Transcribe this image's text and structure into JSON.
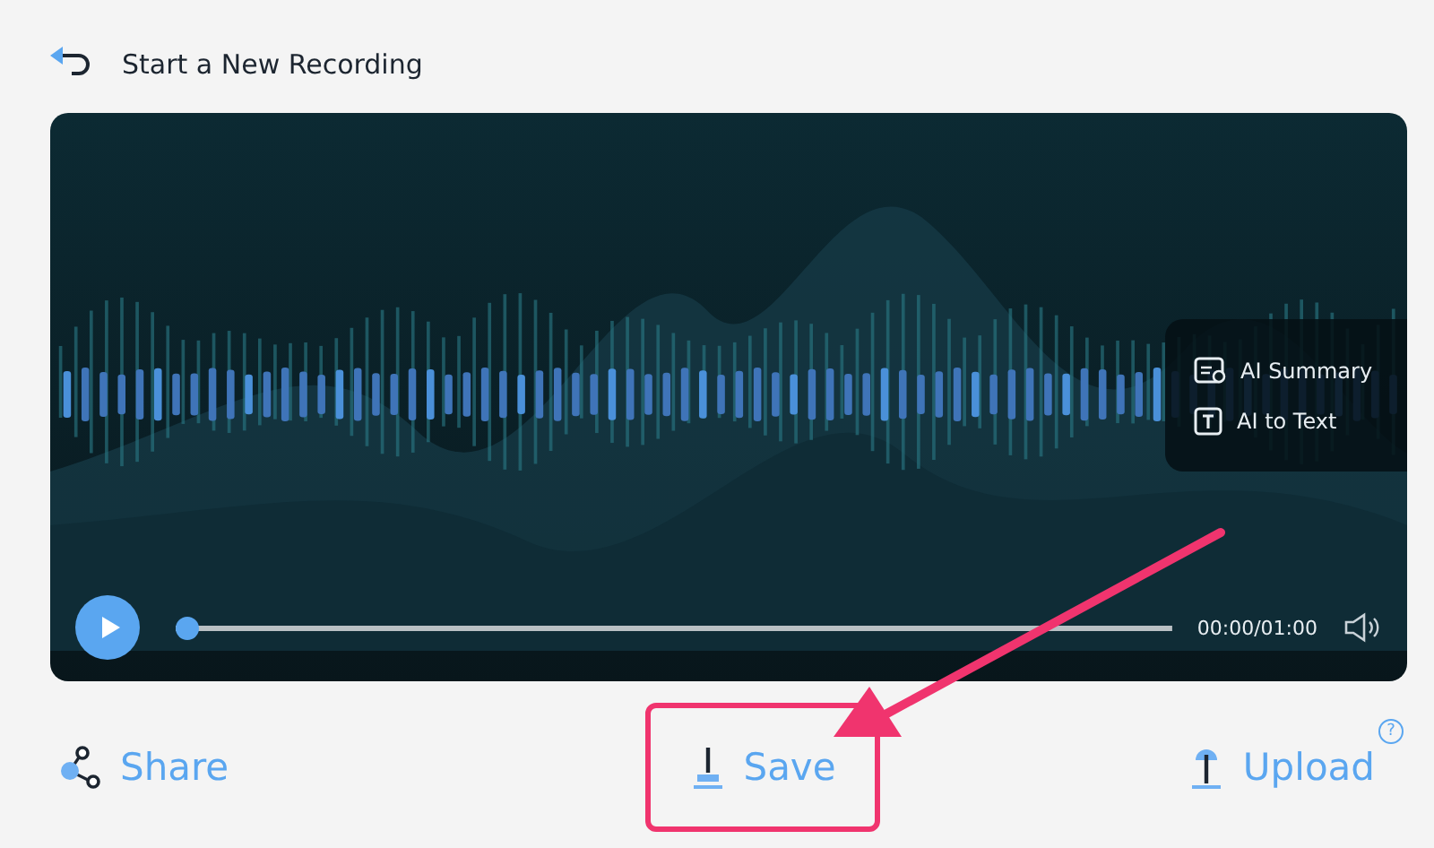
{
  "header": {
    "title": "Start a New Recording"
  },
  "player": {
    "menu": [
      {
        "kind": "summary",
        "label": "AI Summary"
      },
      {
        "kind": "text",
        "label": "AI to Text"
      }
    ],
    "progress": {
      "level": 0
    },
    "time": "00:00/01:00"
  },
  "actions": [
    {
      "kind": "share",
      "label": "Share",
      "highlighted": false
    },
    {
      "kind": "save",
      "label": "Save",
      "highlighted": true
    },
    {
      "kind": "upload",
      "label": "Upload",
      "highlighted": false,
      "help": "?"
    }
  ]
}
